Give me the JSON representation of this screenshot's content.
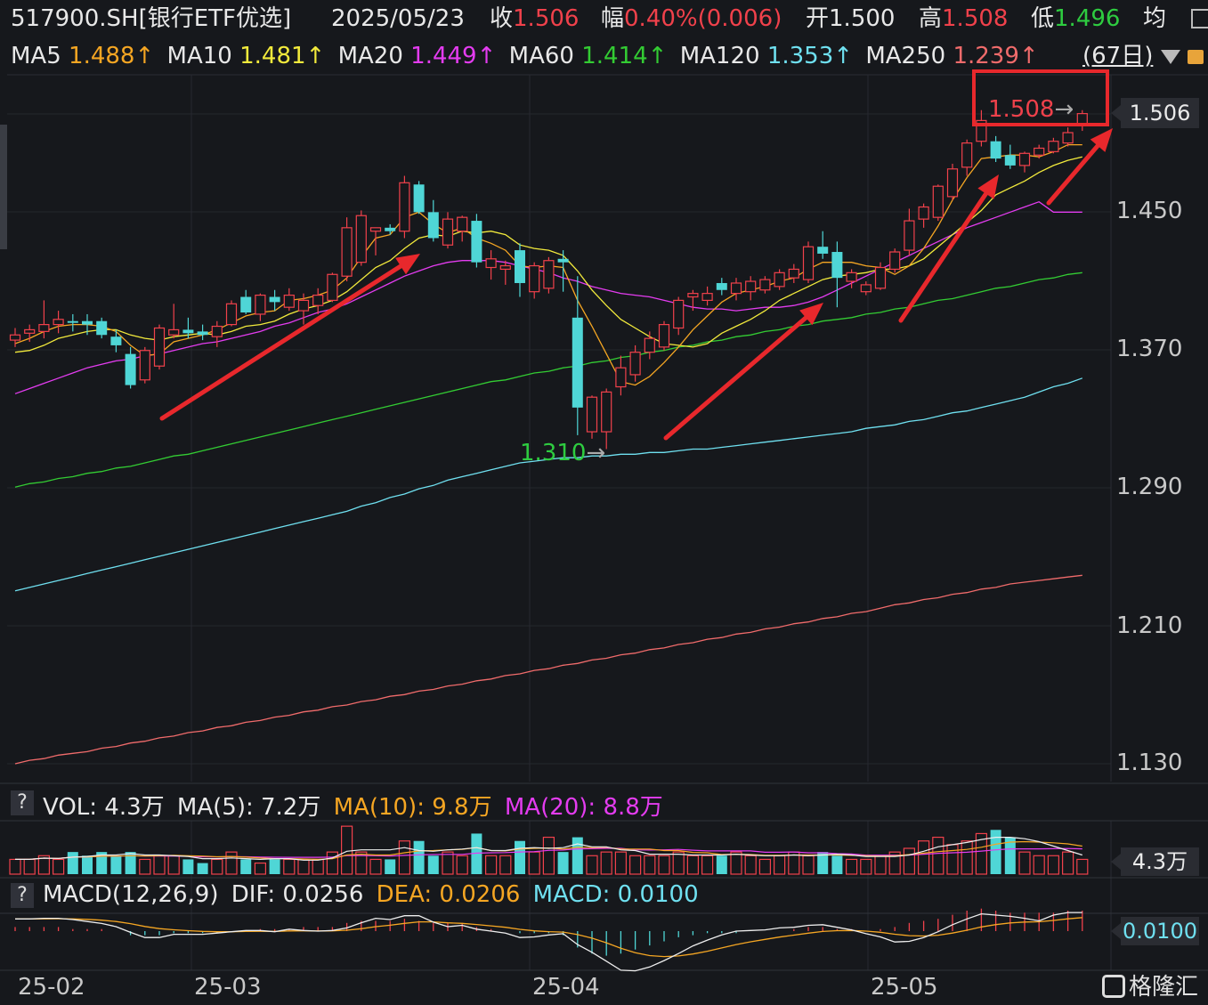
{
  "header": {
    "symbol": "517900.SH[银行ETF优选]",
    "date": "2025/05/23",
    "close_label": "收",
    "close": "1.506",
    "change_label": "幅",
    "change": "0.40%(0.006)",
    "open_label": "开",
    "open": "1.500",
    "high_label": "高",
    "high": "1.508",
    "low_label": "低",
    "low": "1.496",
    "avg_label": "均",
    "ma5_label": "MA5",
    "ma5": "1.488↑",
    "ma10_label": "MA10",
    "ma10": "1.481↑",
    "ma20_label": "MA20",
    "ma20": "1.449↑",
    "ma60_label": "MA60",
    "ma60": "1.414↑",
    "ma120_label": "MA120",
    "ma120": "1.353↑",
    "ma250_label": "MA250",
    "ma250": "1.239↑",
    "period": "(67日)"
  },
  "price_axis": {
    "ticks": [
      "1.450",
      "1.370",
      "1.290",
      "1.210",
      "1.130"
    ],
    "current_price_box": "1.506"
  },
  "annotations": {
    "high": "1.508",
    "low": "1.310"
  },
  "volume_panel": {
    "help": "?",
    "vol_label": "VOL: 4.3万",
    "ma5_label": "MA(5): 7.2万",
    "ma10_label": "MA(10): 9.8万",
    "ma20_label": "MA(20): 8.8万",
    "current_box": "4.3万"
  },
  "macd_panel": {
    "help": "?",
    "title": "MACD(12,26,9)",
    "dif": "DIF: 0.0256",
    "dea": "DEA: 0.0206",
    "macd": "MACD: 0.0100",
    "current_box": "0.0100"
  },
  "x_axis": {
    "labels": [
      "25-02",
      "25-03",
      "25-04",
      "25-05"
    ]
  },
  "watermark": "格隆汇",
  "colors": {
    "up": "#f0414b",
    "down": "#4fd6d6",
    "background": "#16181c",
    "ma5": "#f5a623",
    "ma10": "#f2ea3c",
    "ma20": "#e43cf0",
    "ma60": "#33cc33",
    "ma120": "#6fe0f0",
    "ma250": "#f06b6b"
  },
  "chart_data": {
    "type": "candlestick",
    "ylim": [
      1.11,
      1.53
    ],
    "ohlc": [
      [
        1.375,
        1.382,
        1.371,
        1.378
      ],
      [
        1.379,
        1.384,
        1.374,
        1.381
      ],
      [
        1.38,
        1.398,
        1.376,
        1.384
      ],
      [
        1.384,
        1.392,
        1.379,
        1.387
      ],
      [
        1.386,
        1.39,
        1.38,
        1.385
      ],
      [
        1.386,
        1.39,
        1.378,
        1.384
      ],
      [
        1.386,
        1.388,
        1.376,
        1.378
      ],
      [
        1.377,
        1.381,
        1.368,
        1.372
      ],
      [
        1.367,
        1.371,
        1.347,
        1.349
      ],
      [
        1.352,
        1.371,
        1.35,
        1.369
      ],
      [
        1.36,
        1.384,
        1.358,
        1.382
      ],
      [
        1.378,
        1.396,
        1.376,
        1.381
      ],
      [
        1.381,
        1.388,
        1.376,
        1.379
      ],
      [
        1.38,
        1.384,
        1.375,
        1.378
      ],
      [
        1.377,
        1.386,
        1.371,
        1.383
      ],
      [
        1.384,
        1.398,
        1.383,
        1.396
      ],
      [
        1.4,
        1.404,
        1.39,
        1.391
      ],
      [
        1.39,
        1.402,
        1.386,
        1.401
      ],
      [
        1.4,
        1.404,
        1.392,
        1.397
      ],
      [
        1.394,
        1.405,
        1.392,
        1.401
      ],
      [
        1.392,
        1.402,
        1.384,
        1.398
      ],
      [
        1.395,
        1.405,
        1.39,
        1.401
      ],
      [
        1.398,
        1.414,
        1.397,
        1.413
      ],
      [
        1.412,
        1.446,
        1.409,
        1.44
      ],
      [
        1.42,
        1.45,
        1.418,
        1.447
      ],
      [
        1.438,
        1.44,
        1.424,
        1.44
      ],
      [
        1.44,
        1.442,
        1.436,
        1.438
      ],
      [
        1.438,
        1.47,
        1.434,
        1.466
      ],
      [
        1.465,
        1.467,
        1.448,
        1.449
      ],
      [
        1.449,
        1.456,
        1.432,
        1.434
      ],
      [
        1.43,
        1.449,
        1.428,
        1.445
      ],
      [
        1.438,
        1.447,
        1.432,
        1.446
      ],
      [
        1.444,
        1.448,
        1.417,
        1.42
      ],
      [
        1.417,
        1.427,
        1.41,
        1.422
      ],
      [
        1.416,
        1.421,
        1.407,
        1.418
      ],
      [
        1.427,
        1.431,
        1.4,
        1.408
      ],
      [
        1.403,
        1.42,
        1.399,
        1.418
      ],
      [
        1.405,
        1.423,
        1.402,
        1.421
      ],
      [
        1.422,
        1.427,
        1.403,
        1.42
      ],
      [
        1.388,
        1.412,
        1.32,
        1.336
      ],
      [
        1.322,
        1.343,
        1.318,
        1.342
      ],
      [
        1.322,
        1.347,
        1.312,
        1.345
      ],
      [
        1.348,
        1.366,
        1.343,
        1.359
      ],
      [
        1.355,
        1.372,
        1.351,
        1.368
      ],
      [
        1.368,
        1.38,
        1.364,
        1.376
      ],
      [
        1.371,
        1.386,
        1.369,
        1.384
      ],
      [
        1.382,
        1.4,
        1.378,
        1.398
      ],
      [
        1.4,
        1.404,
        1.392,
        1.402
      ],
      [
        1.398,
        1.406,
        1.395,
        1.402
      ],
      [
        1.408,
        1.411,
        1.401,
        1.404
      ],
      [
        1.402,
        1.411,
        1.398,
        1.408
      ],
      [
        1.403,
        1.412,
        1.398,
        1.409
      ],
      [
        1.404,
        1.412,
        1.402,
        1.41
      ],
      [
        1.406,
        1.416,
        1.404,
        1.414
      ],
      [
        1.411,
        1.419,
        1.408,
        1.416
      ],
      [
        1.41,
        1.432,
        1.408,
        1.429
      ],
      [
        1.429,
        1.438,
        1.422,
        1.425
      ],
      [
        1.426,
        1.432,
        1.394,
        1.411
      ],
      [
        1.409,
        1.416,
        1.405,
        1.414
      ],
      [
        1.403,
        1.409,
        1.401,
        1.407
      ],
      [
        1.405,
        1.42,
        1.404,
        1.417
      ],
      [
        1.416,
        1.428,
        1.414,
        1.426
      ],
      [
        1.427,
        1.451,
        1.424,
        1.444
      ],
      [
        1.445,
        1.454,
        1.44,
        1.452
      ],
      [
        1.446,
        1.465,
        1.444,
        1.464
      ],
      [
        1.458,
        1.477,
        1.456,
        1.474
      ],
      [
        1.475,
        1.491,
        1.47,
        1.489
      ],
      [
        1.49,
        1.508,
        1.487,
        1.502
      ],
      [
        1.49,
        1.493,
        1.478,
        1.48
      ],
      [
        1.482,
        1.488,
        1.474,
        1.476
      ],
      [
        1.476,
        1.484,
        1.472,
        1.483
      ],
      [
        1.482,
        1.488,
        1.48,
        1.486
      ],
      [
        1.484,
        1.492,
        1.483,
        1.49
      ],
      [
        1.489,
        1.498,
        1.487,
        1.495
      ],
      [
        1.5,
        1.508,
        1.496,
        1.506
      ]
    ],
    "ma5": [
      1.373,
      1.376,
      1.38,
      1.383,
      1.384,
      1.384,
      1.383,
      1.38,
      1.372,
      1.366,
      1.367,
      1.374,
      1.376,
      1.378,
      1.381,
      1.385,
      1.389,
      1.391,
      1.392,
      1.398,
      1.399,
      1.401,
      1.404,
      1.411,
      1.423,
      1.434,
      1.436,
      1.446,
      1.449,
      1.442,
      1.437,
      1.44,
      1.434,
      1.431,
      1.427,
      1.418,
      1.417,
      1.418,
      1.417,
      1.398,
      1.383,
      1.367,
      1.351,
      1.349,
      1.354,
      1.362,
      1.371,
      1.381,
      1.389,
      1.397,
      1.402,
      1.404,
      1.406,
      1.409,
      1.411,
      1.416,
      1.42,
      1.42,
      1.42,
      1.418,
      1.417,
      1.413,
      1.418,
      1.428,
      1.441,
      1.456,
      1.469,
      1.48,
      1.481,
      1.482,
      1.482,
      1.481,
      1.484,
      1.488,
      1.488
    ],
    "ma10": [
      1.368,
      1.369,
      1.372,
      1.376,
      1.378,
      1.38,
      1.381,
      1.381,
      1.378,
      1.376,
      1.375,
      1.377,
      1.378,
      1.379,
      1.378,
      1.38,
      1.383,
      1.384,
      1.386,
      1.39,
      1.393,
      1.395,
      1.398,
      1.403,
      1.41,
      1.417,
      1.421,
      1.428,
      1.434,
      1.436,
      1.435,
      1.438,
      1.437,
      1.438,
      1.436,
      1.43,
      1.428,
      1.427,
      1.424,
      1.415,
      1.404,
      1.395,
      1.387,
      1.382,
      1.377,
      1.373,
      1.372,
      1.371,
      1.373,
      1.379,
      1.383,
      1.387,
      1.392,
      1.398,
      1.402,
      1.406,
      1.41,
      1.412,
      1.413,
      1.414,
      1.416,
      1.416,
      1.418,
      1.422,
      1.429,
      1.436,
      1.443,
      1.45,
      1.459,
      1.463,
      1.467,
      1.472,
      1.476,
      1.479,
      1.481
    ],
    "ma20": [
      1.344,
      1.347,
      1.35,
      1.353,
      1.356,
      1.359,
      1.361,
      1.363,
      1.364,
      1.366,
      1.367,
      1.369,
      1.371,
      1.373,
      1.374,
      1.376,
      1.378,
      1.38,
      1.383,
      1.385,
      1.388,
      1.391,
      1.393,
      1.396,
      1.4,
      1.404,
      1.408,
      1.412,
      1.415,
      1.418,
      1.42,
      1.421,
      1.421,
      1.421,
      1.42,
      1.418,
      1.416,
      1.414,
      1.411,
      1.409,
      1.406,
      1.404,
      1.402,
      1.401,
      1.4,
      1.398,
      1.396,
      1.394,
      1.393,
      1.393,
      1.392,
      1.393,
      1.394,
      1.394,
      1.395,
      1.397,
      1.4,
      1.404,
      1.408,
      1.412,
      1.416,
      1.42,
      1.424,
      1.428,
      1.432,
      1.436,
      1.44,
      1.443,
      1.446,
      1.449,
      1.452,
      1.455,
      1.449,
      1.449,
      1.449
    ],
    "ma60": [
      1.29,
      1.292,
      1.293,
      1.295,
      1.296,
      1.298,
      1.299,
      1.301,
      1.302,
      1.304,
      1.306,
      1.308,
      1.309,
      1.311,
      1.313,
      1.315,
      1.317,
      1.319,
      1.321,
      1.323,
      1.325,
      1.327,
      1.329,
      1.331,
      1.333,
      1.335,
      1.337,
      1.339,
      1.341,
      1.343,
      1.345,
      1.347,
      1.349,
      1.351,
      1.352,
      1.354,
      1.356,
      1.357,
      1.359,
      1.36,
      1.362,
      1.363,
      1.365,
      1.366,
      1.368,
      1.369,
      1.371,
      1.372,
      1.374,
      1.375,
      1.377,
      1.378,
      1.38,
      1.381,
      1.383,
      1.384,
      1.386,
      1.387,
      1.388,
      1.39,
      1.391,
      1.393,
      1.394,
      1.396,
      1.398,
      1.399,
      1.401,
      1.403,
      1.405,
      1.406,
      1.408,
      1.41,
      1.411,
      1.413,
      1.414
    ],
    "ma120": [
      1.23,
      1.232,
      1.234,
      1.236,
      1.238,
      1.24,
      1.242,
      1.244,
      1.246,
      1.248,
      1.25,
      1.252,
      1.254,
      1.256,
      1.258,
      1.26,
      1.262,
      1.264,
      1.266,
      1.268,
      1.27,
      1.272,
      1.274,
      1.276,
      1.279,
      1.281,
      1.284,
      1.286,
      1.289,
      1.291,
      1.294,
      1.296,
      1.298,
      1.3,
      1.302,
      1.304,
      1.305,
      1.306,
      1.307,
      1.307,
      1.308,
      1.308,
      1.309,
      1.309,
      1.31,
      1.31,
      1.311,
      1.312,
      1.312,
      1.313,
      1.314,
      1.315,
      1.316,
      1.317,
      1.318,
      1.319,
      1.32,
      1.321,
      1.322,
      1.324,
      1.325,
      1.326,
      1.328,
      1.329,
      1.331,
      1.333,
      1.334,
      1.336,
      1.338,
      1.34,
      1.342,
      1.345,
      1.348,
      1.35,
      1.353
    ],
    "ma250": [
      1.13,
      1.132,
      1.133,
      1.135,
      1.136,
      1.137,
      1.139,
      1.14,
      1.142,
      1.143,
      1.145,
      1.146,
      1.148,
      1.149,
      1.151,
      1.152,
      1.154,
      1.155,
      1.157,
      1.158,
      1.16,
      1.161,
      1.163,
      1.164,
      1.166,
      1.167,
      1.169,
      1.17,
      1.172,
      1.173,
      1.175,
      1.176,
      1.178,
      1.179,
      1.181,
      1.182,
      1.184,
      1.185,
      1.187,
      1.188,
      1.19,
      1.191,
      1.193,
      1.194,
      1.196,
      1.197,
      1.199,
      1.2,
      1.202,
      1.203,
      1.205,
      1.206,
      1.208,
      1.209,
      1.211,
      1.212,
      1.214,
      1.215,
      1.217,
      1.218,
      1.22,
      1.222,
      1.223,
      1.225,
      1.226,
      1.228,
      1.229,
      1.231,
      1.232,
      1.234,
      1.235,
      1.236,
      1.237,
      1.238,
      1.239
    ],
    "volume": [
      4,
      4,
      5,
      4,
      6,
      5,
      6,
      5,
      6,
      4,
      5,
      5,
      4,
      3,
      4,
      6,
      4,
      3,
      4,
      4,
      4,
      4,
      6,
      13,
      6,
      4,
      4,
      9,
      9,
      5,
      6,
      5,
      11,
      5,
      5,
      9,
      6,
      10,
      6,
      10,
      5,
      6,
      6,
      5,
      5,
      5,
      6,
      5,
      5,
      5,
      6,
      5,
      4,
      5,
      6,
      5,
      6,
      5,
      4,
      4,
      5,
      6,
      7,
      9,
      10,
      8,
      9,
      11,
      12,
      10,
      6,
      5,
      5,
      6,
      4
    ],
    "macd": [
      0.002,
      0.002,
      0.002,
      0.002,
      0.001,
      0.001,
      0.001,
      0.0,
      -0.002,
      -0.002,
      -0.002,
      -0.001,
      -0.001,
      -0.001,
      -0.001,
      0.0,
      0.0,
      0.001,
      0.001,
      0.001,
      0.002,
      0.002,
      0.002,
      0.004,
      0.005,
      0.005,
      0.005,
      0.006,
      0.005,
      0.004,
      0.004,
      0.004,
      0.002,
      0.001,
      0.0,
      -0.001,
      -0.001,
      -0.001,
      -0.002,
      -0.008,
      -0.011,
      -0.012,
      -0.011,
      -0.009,
      -0.007,
      -0.005,
      -0.003,
      -0.002,
      -0.001,
      -0.001,
      -0.001,
      0.0,
      0.0,
      0.0,
      0.001,
      0.002,
      0.002,
      0.001,
      0.001,
      0.0,
      0.001,
      0.002,
      0.004,
      0.005,
      0.006,
      0.008,
      0.01,
      0.011,
      0.01,
      0.009,
      0.009,
      0.009,
      0.009,
      0.01,
      0.01
    ]
  }
}
